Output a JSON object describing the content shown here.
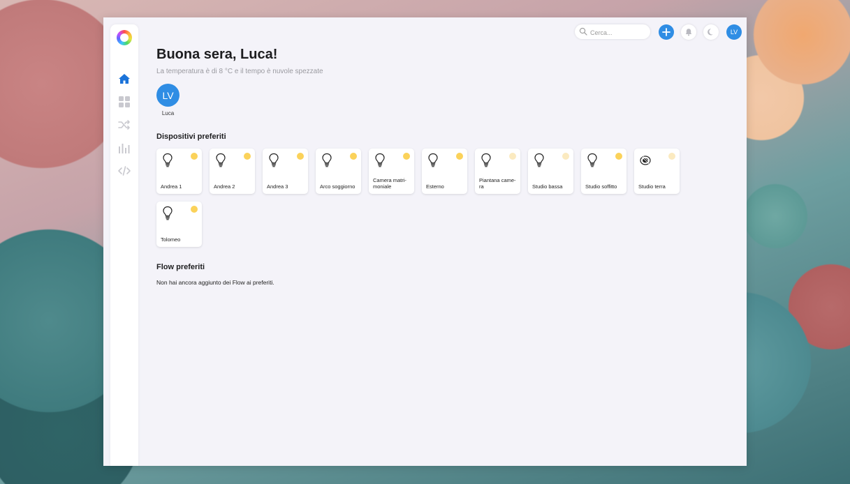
{
  "search": {
    "placeholder": "Cerca..."
  },
  "user": {
    "initials": "LV",
    "name": "Luca"
  },
  "greeting": "Buona sera, Luca!",
  "weather_line": "La temperatura è di 8 °C e il tempo è nuvole spezzate",
  "favorites_devices_title": "Dispositivi preferiti",
  "devices": [
    {
      "name": "Andrea 1",
      "on": true,
      "icon": "bulb-icon"
    },
    {
      "name": "Andrea 2",
      "on": true,
      "icon": "bulb-icon"
    },
    {
      "name": "Andrea 3",
      "on": true,
      "icon": "bulb-icon"
    },
    {
      "name": "Arco soggiorno",
      "on": true,
      "icon": "bulb-icon"
    },
    {
      "name": "Camera matri-moniale",
      "on": true,
      "icon": "bulb-icon"
    },
    {
      "name": "Esterno",
      "on": true,
      "icon": "bulb-icon"
    },
    {
      "name": "Piantana came-ra",
      "on": false,
      "icon": "bulb-icon"
    },
    {
      "name": "Studio bassa",
      "on": false,
      "icon": "bulb-icon"
    },
    {
      "name": "Studio soffitto",
      "on": true,
      "icon": "bulb-icon"
    },
    {
      "name": "Studio terra",
      "on": false,
      "icon": "spot-lamp-icon"
    },
    {
      "name": "Tolomeo",
      "on": true,
      "icon": "bulb-icon"
    }
  ],
  "favorites_flow_title": "Flow preferiti",
  "flow_empty_text": "Non hai ancora aggiunto dei Flow ai preferiti.",
  "colors": {
    "accent": "#2f8de4",
    "sun_on": "#fbd25a",
    "sun_off": "#fbeac0"
  }
}
